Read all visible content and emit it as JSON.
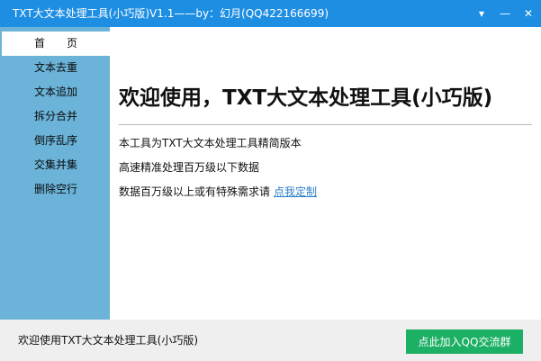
{
  "window": {
    "title": "TXT大文本处理工具(小巧版)V1.1——by：幻月(QQ422166699)",
    "controls": [
      {
        "icon": "menu-arrow-icon",
        "glyph": "▾"
      },
      {
        "icon": "minimize-icon",
        "glyph": "—"
      },
      {
        "icon": "close-icon",
        "glyph": "✕"
      }
    ]
  },
  "sidebar": {
    "items": [
      {
        "label": "首　　页",
        "active": true
      },
      {
        "label": "文本去重"
      },
      {
        "label": "文本追加"
      },
      {
        "label": "拆分合并"
      },
      {
        "label": "倒序乱序"
      },
      {
        "label": "交集并集"
      },
      {
        "label": "删除空行"
      }
    ]
  },
  "main": {
    "heading": "欢迎使用，TXT大文本处理工具(小巧版)",
    "lines": [
      "本工具为TXT大文本处理工具精简版本",
      "高速精准处理百万级以下数据",
      "数据百万级以上或有特殊需求请"
    ],
    "link_label": "点我定制"
  },
  "statusbar": {
    "text": "欢迎使用TXT大文本处理工具(小巧版)",
    "qq_button": "点此加入QQ交流群"
  },
  "colors": {
    "titlebar": "#1e8ee3",
    "sidebar": "#6bb3d8",
    "link": "#2c7fc9",
    "qq_button": "#1cb065"
  }
}
